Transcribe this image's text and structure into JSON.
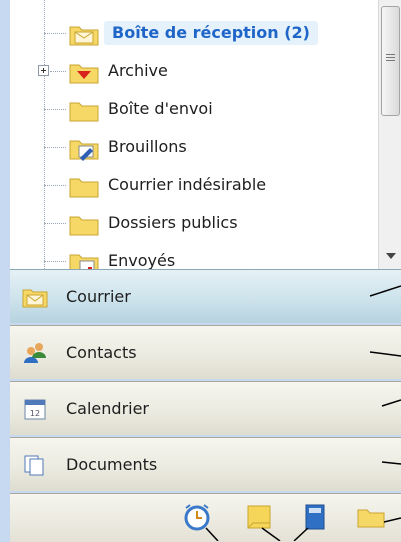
{
  "folder_tree": {
    "items": [
      {
        "label": "Boîte de réception (2)",
        "icon": "inbox-folder-icon",
        "selected": true
      },
      {
        "label": "Archive",
        "icon": "archive-folder-icon",
        "expandable": true
      },
      {
        "label": "Boîte d'envoi",
        "icon": "outbox-folder-icon"
      },
      {
        "label": "Brouillons",
        "icon": "drafts-folder-icon"
      },
      {
        "label": "Courrier indésirable",
        "icon": "junk-folder-icon"
      },
      {
        "label": "Dossiers publics",
        "icon": "public-folders-icon"
      },
      {
        "label": "Envoyés",
        "icon": "sent-folder-icon"
      }
    ]
  },
  "nav_buttons": [
    {
      "label": "Courrier",
      "icon": "mail-icon",
      "active": true
    },
    {
      "label": "Contacts",
      "icon": "contacts-icon"
    },
    {
      "label": "Calendrier",
      "icon": "calendar-icon"
    },
    {
      "label": "Documents",
      "icon": "documents-icon"
    }
  ],
  "shortcuts": [
    {
      "icon": "reminder-clock-icon"
    },
    {
      "icon": "notes-icon"
    },
    {
      "icon": "journal-icon"
    },
    {
      "icon": "folder-list-icon"
    }
  ],
  "colors": {
    "background": "#c6d9f0",
    "selected_text": "#1f66c8",
    "selected_highlight": "#e5f1fb",
    "active_nav": "#cde3ec",
    "nav": "#ecebe1",
    "folder_yellow": "#f5d866"
  }
}
